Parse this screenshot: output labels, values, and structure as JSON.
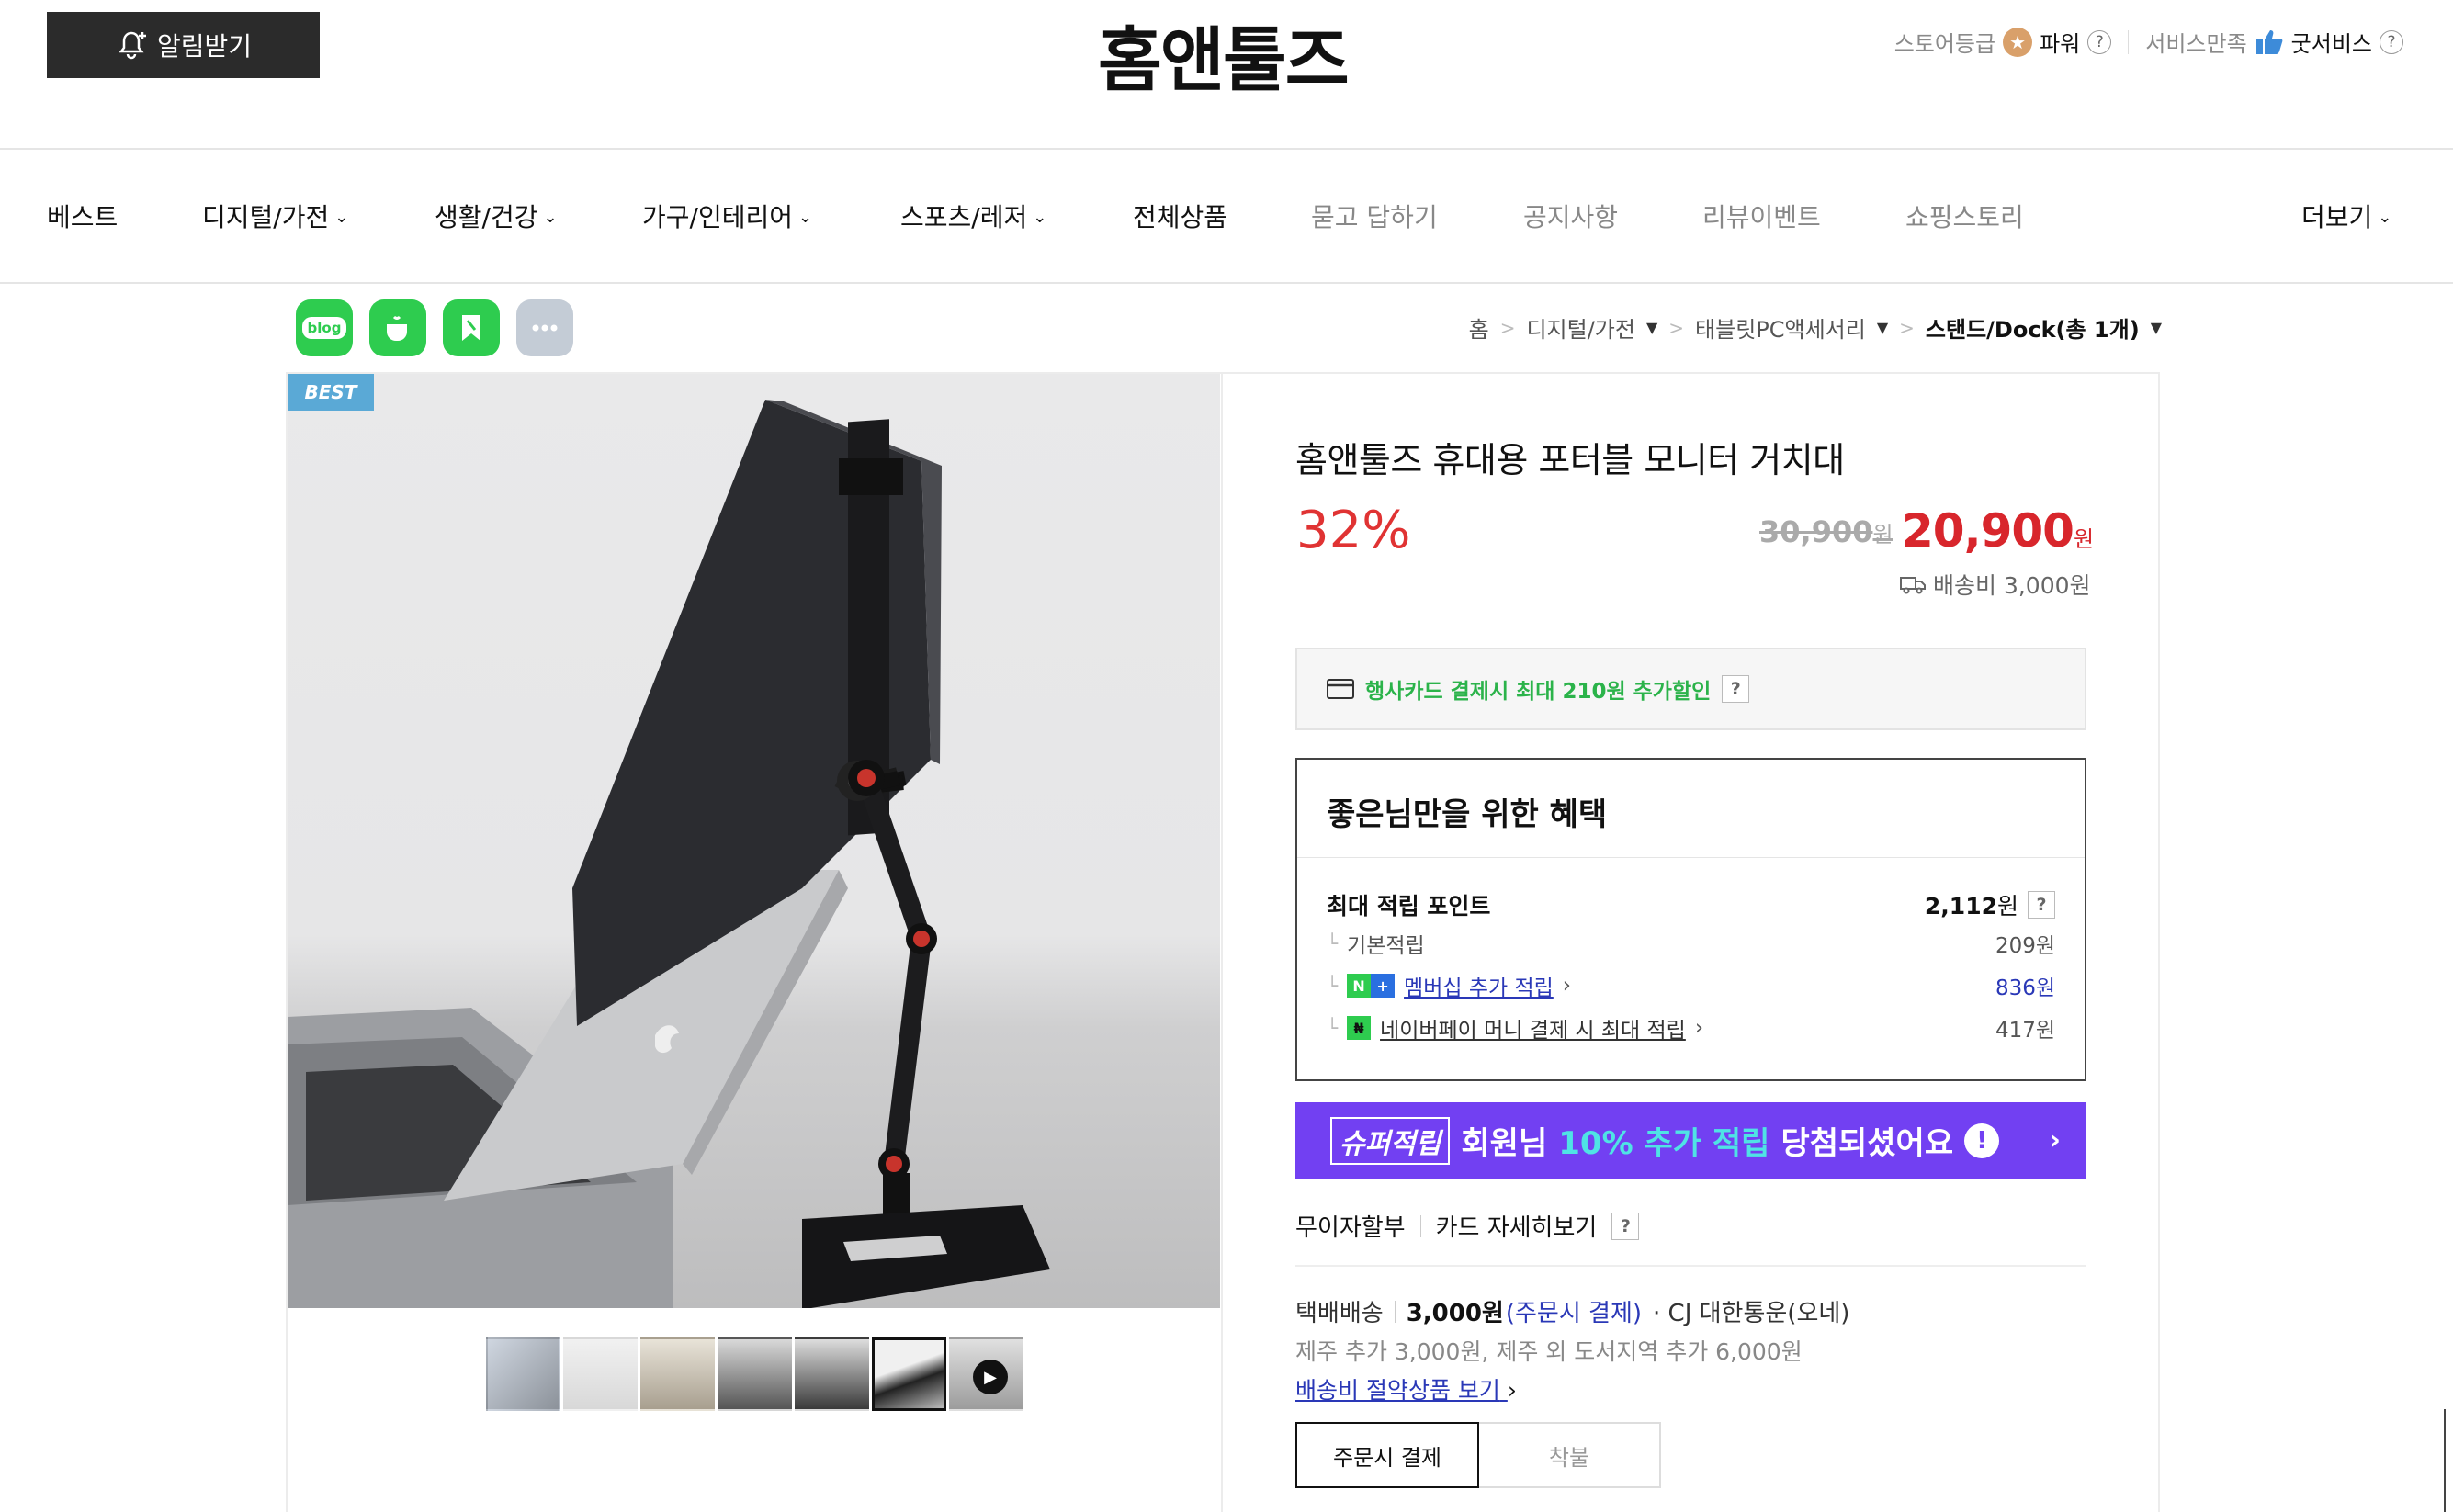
{
  "header": {
    "alarm_label": "알림받기",
    "logo": "홈앤툴즈",
    "store_grade_label": "스토어등급",
    "store_grade_value": "파워",
    "service_label": "서비스만족",
    "service_value": "굿서비스",
    "help_mark": "?"
  },
  "nav": {
    "items": [
      "베스트",
      "디지털/가전",
      "생활/건강",
      "가구/인테리어",
      "스포츠/레저",
      "전체상품",
      "묻고 답하기",
      "공지사항",
      "리뷰이벤트",
      "쇼핑스토리",
      "더보기"
    ]
  },
  "share": {
    "blog_label": "blog"
  },
  "breadcrumb": {
    "home": "홈",
    "level1": "디지털/가전",
    "level2": "태블릿PC액세서리",
    "current": "스탠드/Dock(총 1개)"
  },
  "badge": "BEST",
  "product": {
    "title": "홈앤툴즈 휴대용 포터블 모니터 거치대",
    "discount": "32%",
    "original_price": "30,900",
    "sale_price": "20,900",
    "currency": "원",
    "shipping_fee": "배송비 3,000원"
  },
  "card_promo": {
    "text": "행사카드 결제시 최대 210원 추가할인",
    "help": "?"
  },
  "benefit": {
    "title": "좋은님만을 위한 혜택",
    "max_points_label": "최대 적립 포인트",
    "max_points_value": "2,112",
    "max_points_unit": "원",
    "help": "?",
    "basic_label": "기본적립",
    "basic_value": "209원",
    "membership_label": "멤버십 추가 적립",
    "membership_value": "836원",
    "npay_label": "네이버페이 머니 결제 시 최대 적립",
    "npay_value": "417원"
  },
  "super_save": {
    "tag": "슈퍼적립",
    "text_prefix": "회원님",
    "text_accent": "10% 추가 적립",
    "text_suffix": "당첨되셨어요",
    "bang": "!"
  },
  "installment": {
    "label": "무이자할부",
    "card_link": "카드 자세히보기",
    "help": "?"
  },
  "delivery": {
    "method": "택배배송",
    "fee": "3,000원",
    "fee_note": "(주문시 결제)",
    "carrier": "· CJ 대한통운(오네)",
    "extra": "제주 추가 3,000원, 제주 외 도서지역 추가 6,000원",
    "save_link": "배송비 절약상품 보기"
  },
  "pay_toggle": {
    "order": "주문시 결제",
    "cod": "착불"
  },
  "colors": {
    "accent_red": "#d8262c",
    "discount_red": "#e03333",
    "naver_green": "#2ecc4f",
    "super_purple": "#7240f2",
    "link_blue": "#2a38b7"
  }
}
